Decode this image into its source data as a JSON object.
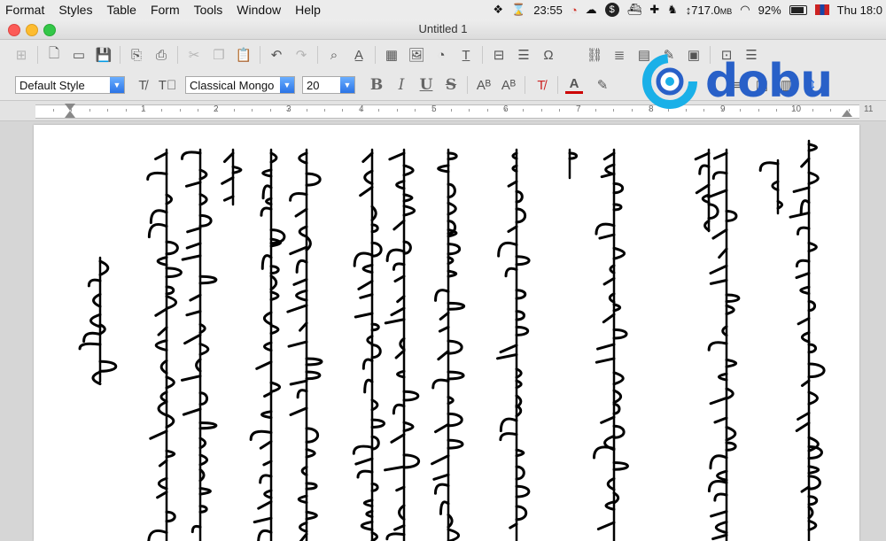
{
  "menubar": {
    "items": [
      "Format",
      "Styles",
      "Table",
      "Form",
      "Tools",
      "Window",
      "Help"
    ],
    "clock_time": "23:55",
    "memory": "717.0",
    "memory_unit": "MB",
    "battery": "92%",
    "datetime": "Thu 18:0"
  },
  "window": {
    "title": "Untitled 1"
  },
  "format_bar": {
    "paragraph_style": "Default Style",
    "font_name": "Classical Mongo",
    "font_size": "20"
  },
  "ruler": {
    "numbers": [
      "1",
      "2",
      "3",
      "4",
      "5",
      "6",
      "7",
      "8",
      "9",
      "10",
      "11"
    ]
  },
  "watermark": {
    "brand": "dobu"
  },
  "colors": {
    "accent": "#2b74e6",
    "font_color": "#cc0000",
    "logo_blue": "#2860c8",
    "logo_cyan": "#1ab0e8"
  }
}
